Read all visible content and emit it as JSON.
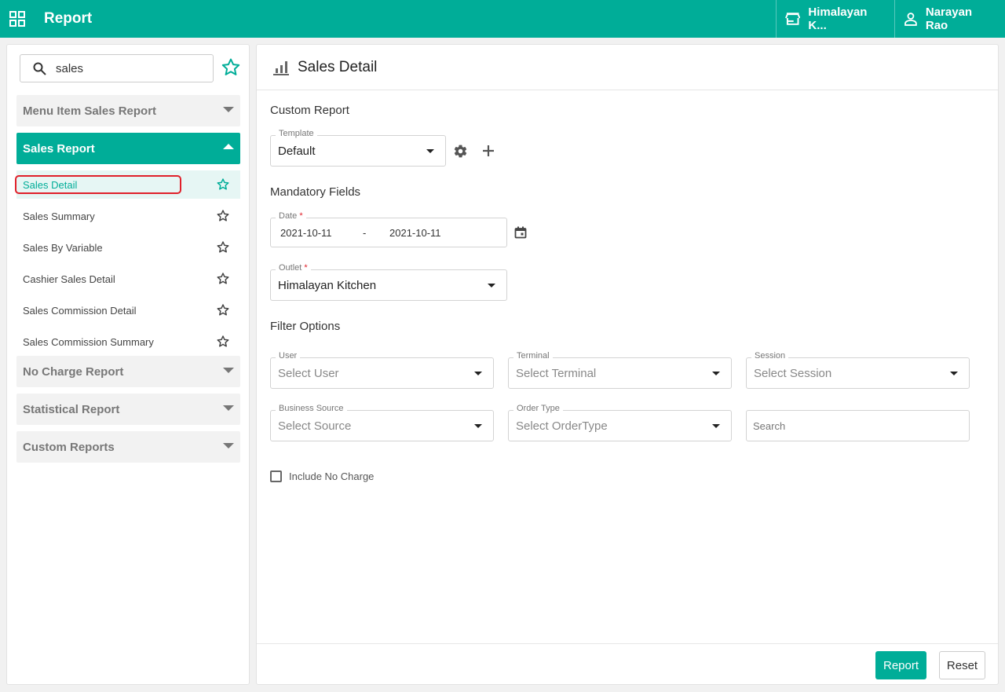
{
  "header": {
    "title": "Report",
    "outlet": "Himalayan K...",
    "user": "Narayan Rao"
  },
  "sidebar": {
    "search_value": "sales",
    "groups": {
      "menu_item": "Menu Item Sales Report",
      "sales_report": "Sales Report",
      "no_charge": "No Charge Report",
      "statistical": "Statistical Report",
      "custom": "Custom Reports"
    },
    "items": [
      {
        "label": "Sales Detail"
      },
      {
        "label": "Sales Summary"
      },
      {
        "label": "Sales By Variable"
      },
      {
        "label": "Cashier Sales Detail"
      },
      {
        "label": "Sales Commission Detail"
      },
      {
        "label": "Sales Commission Summary"
      }
    ]
  },
  "main": {
    "page_title": "Sales Detail",
    "custom_report": {
      "title": "Custom Report",
      "template_label": "Template",
      "template_value": "Default"
    },
    "mandatory": {
      "title": "Mandatory Fields",
      "date_label": "Date",
      "required_mark": "*",
      "date_from": "2021-10-11",
      "date_sep": "-",
      "date_to": "2021-10-11",
      "outlet_label": "Outlet",
      "outlet_value": "Himalayan Kitchen"
    },
    "filters": {
      "title": "Filter Options",
      "user_label": "User",
      "user_placeholder": "Select User",
      "terminal_label": "Terminal",
      "terminal_placeholder": "Select Terminal",
      "session_label": "Session",
      "session_placeholder": "Select Session",
      "source_label": "Business Source",
      "source_placeholder": "Select Source",
      "ordertype_label": "Order Type",
      "ordertype_placeholder": "Select OrderType",
      "search_placeholder": "Search",
      "include_no_charge": "Include No Charge"
    },
    "footer": {
      "report_label": "Report",
      "reset_label": "Reset"
    }
  },
  "colors": {
    "brand": "#00ad98",
    "highlight": "#e0202a"
  }
}
